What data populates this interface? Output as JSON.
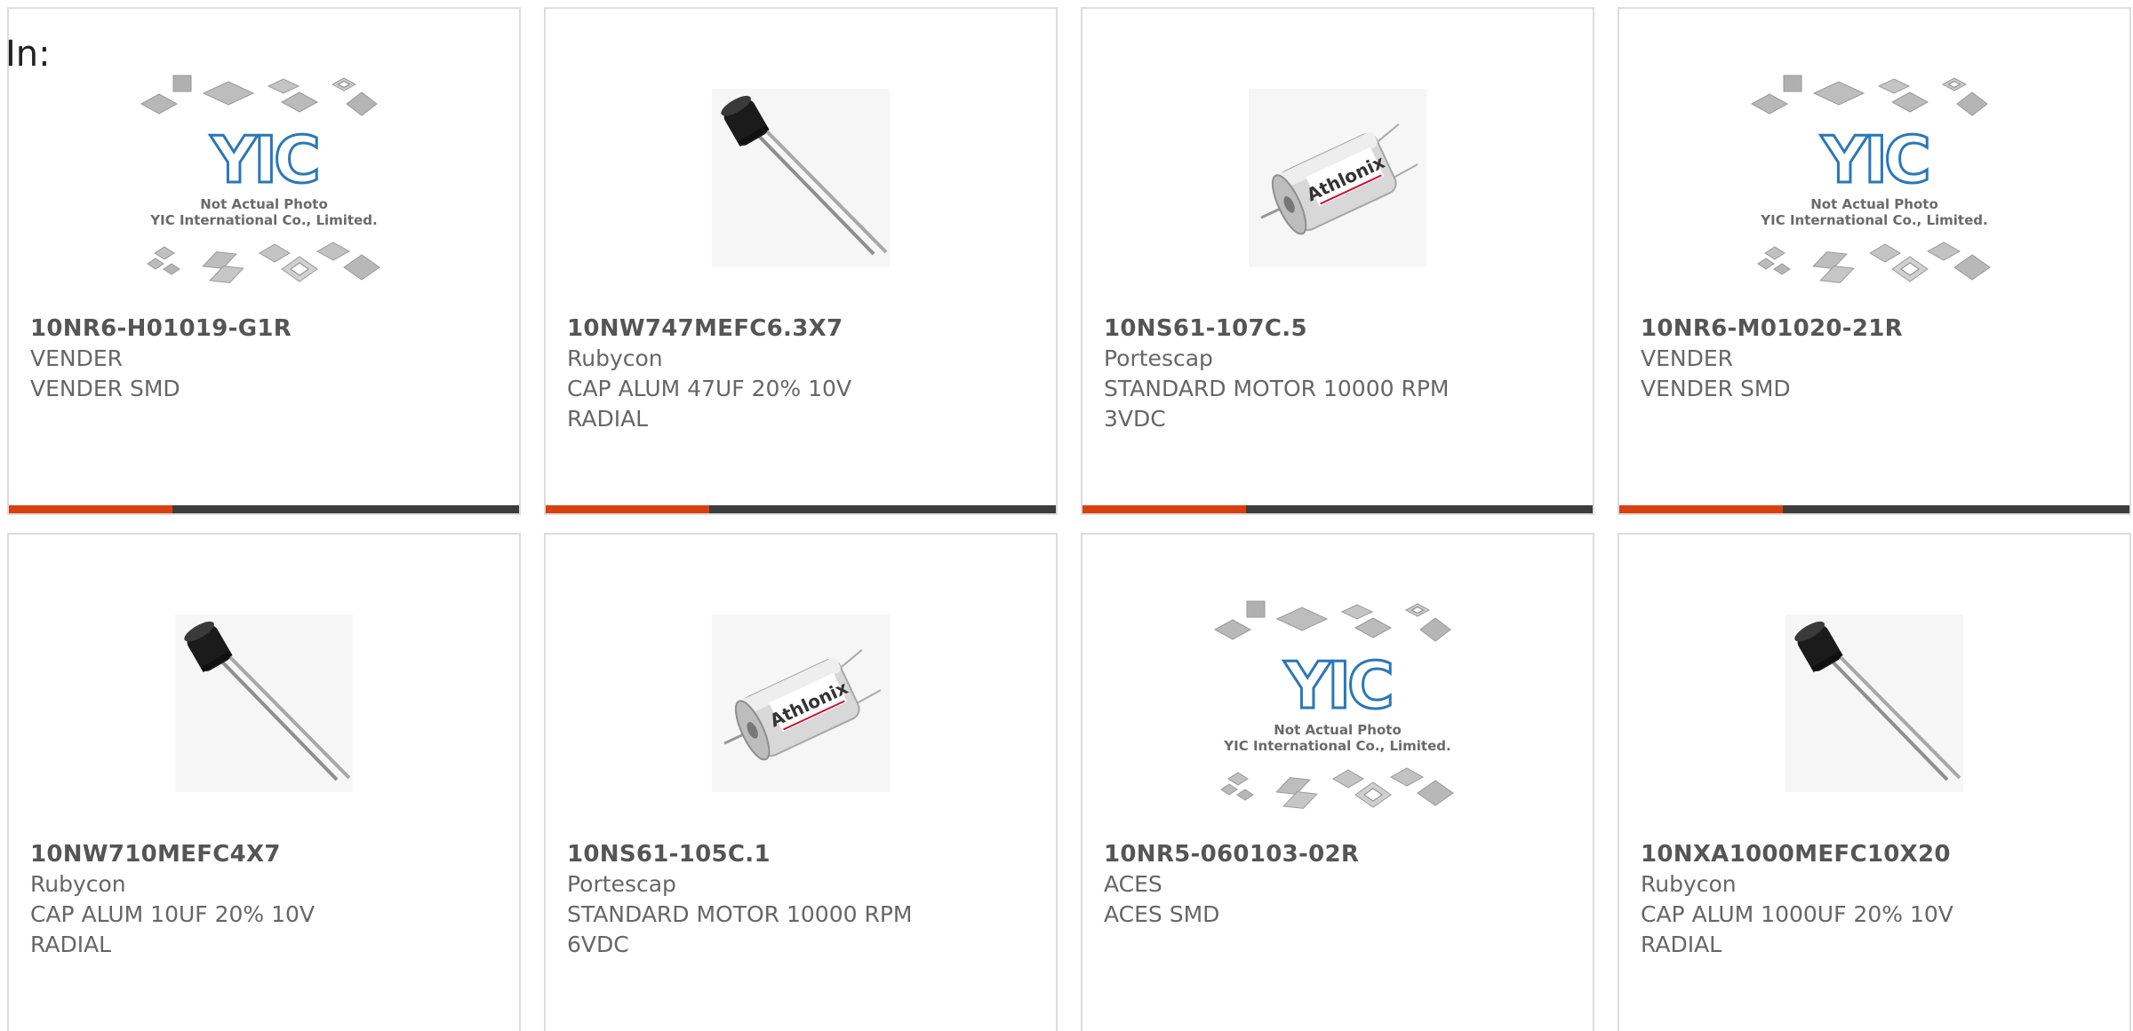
{
  "header": {
    "in_label": "In:"
  },
  "colors": {
    "accent": "#d8400f",
    "bar": "#3c3c3c",
    "border": "#dcdcdc",
    "text": "#555555"
  },
  "products": [
    {
      "part": "10NR6-H01019-G1R",
      "maker": "VENDER",
      "desc": "VENDER SMD",
      "image": "placeholder-logo",
      "progress": 0.32
    },
    {
      "part": "10NW747MEFC6.3X7",
      "maker": "Rubycon",
      "desc": "CAP ALUM 47UF 20% 10V\nRADIAL",
      "image": "capacitor",
      "progress": 0.32
    },
    {
      "part": "10NS61-107C.5",
      "maker": "Portescap",
      "desc": "STANDARD MOTOR 10000 RPM\n3VDC",
      "image": "motor",
      "progress": 0.32
    },
    {
      "part": "10NR6-M01020-21R",
      "maker": "VENDER",
      "desc": "VENDER SMD",
      "image": "placeholder-logo",
      "progress": 0.32
    },
    {
      "part": "10NW710MEFC4X7",
      "maker": "Rubycon",
      "desc": "CAP ALUM 10UF 20% 10V\nRADIAL",
      "image": "capacitor",
      "progress": 0.32
    },
    {
      "part": "10NS61-105C.1",
      "maker": "Portescap",
      "desc": "STANDARD MOTOR 10000 RPM\n6VDC",
      "image": "motor",
      "progress": 0.32
    },
    {
      "part": "10NR5-060103-02R",
      "maker": "ACES",
      "desc": "ACES SMD",
      "image": "placeholder-logo",
      "progress": 0.32
    },
    {
      "part": "10NXA1000MEFC10X20",
      "maker": "Rubycon",
      "desc": "CAP ALUM 1000UF 20% 10V\nRADIAL",
      "image": "capacitor",
      "progress": 0.32
    }
  ],
  "placeholder": {
    "logo_text": "YIC",
    "line1": "Not Actual Photo",
    "line2": "YIC International Co., Limited."
  },
  "motor_brand": "Athlonix"
}
